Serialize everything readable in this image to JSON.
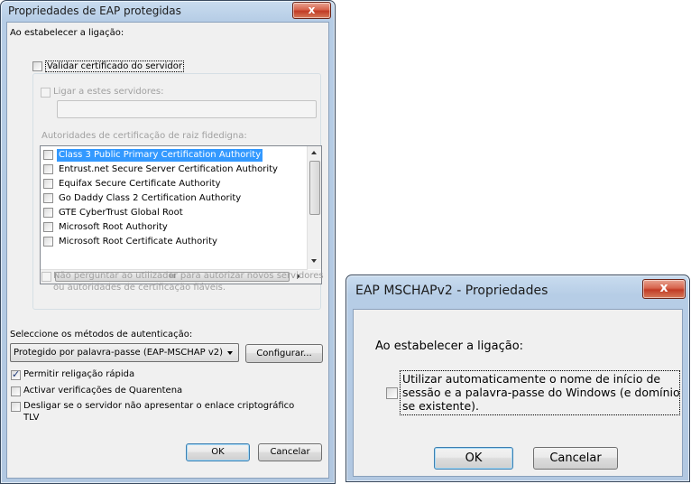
{
  "dialog1": {
    "title": "Propriedades de EAP protegidas",
    "close_symbol": "x",
    "connect_label": "Ao estabelecer a ligação:",
    "validate_cert": {
      "label": "Validar certificado do servidor",
      "checked": false
    },
    "connect_servers": {
      "label": "Ligar a estes servidores:",
      "checked": false,
      "value": ""
    },
    "root_ca_label": "Autoridades de certificação de raiz fidedigna:",
    "ca_list": [
      {
        "label": "Class 3 Public Primary Certification Authority",
        "checked": false,
        "selected": true
      },
      {
        "label": "Entrust.net Secure Server Certification Authority",
        "checked": false
      },
      {
        "label": "Equifax Secure Certificate Authority",
        "checked": false
      },
      {
        "label": "Go Daddy Class 2 Certification Authority",
        "checked": false
      },
      {
        "label": "GTE CyberTrust Global Root",
        "checked": false
      },
      {
        "label": "Microsoft Root Authority",
        "checked": false
      },
      {
        "label": "Microsoft Root Certificate Authority",
        "checked": false
      }
    ],
    "hscroll_grip": "III",
    "no_prompt": {
      "line1": "Não perguntar ao utilizador para autorizar novos servidores",
      "line2": "ou autoridades de certificação fiáveis.",
      "checked": false
    },
    "auth_method_label": "Seleccione os métodos de autenticação:",
    "auth_method_value": "Protegido por palavra-passe (EAP-MSCHAP v2)",
    "configure_label": "Configurar...",
    "fast_reconnect": {
      "label": "Permitir religação rápida",
      "checked": true
    },
    "quarantine": {
      "label": "Activar verificações de Quarentena",
      "checked": false
    },
    "disconnect_tlv": {
      "line1": "Desligar se o servidor não apresentar o enlace criptográfico",
      "line2": "TLV",
      "checked": false
    },
    "ok_label": "OK",
    "cancel_label": "Cancelar"
  },
  "dialog2": {
    "title": "EAP MSCHAPv2 - Propriedades",
    "close_symbol": "x",
    "connect_label": "Ao estabelecer a ligação:",
    "auto_logon": {
      "line1": "Utilizar automaticamente o nome de início de",
      "line2": "sessão e a palavra-passe do Windows (e domínio",
      "line3": "se existente).",
      "checked": false
    },
    "ok_label": "OK",
    "cancel_label": "Cancelar"
  }
}
